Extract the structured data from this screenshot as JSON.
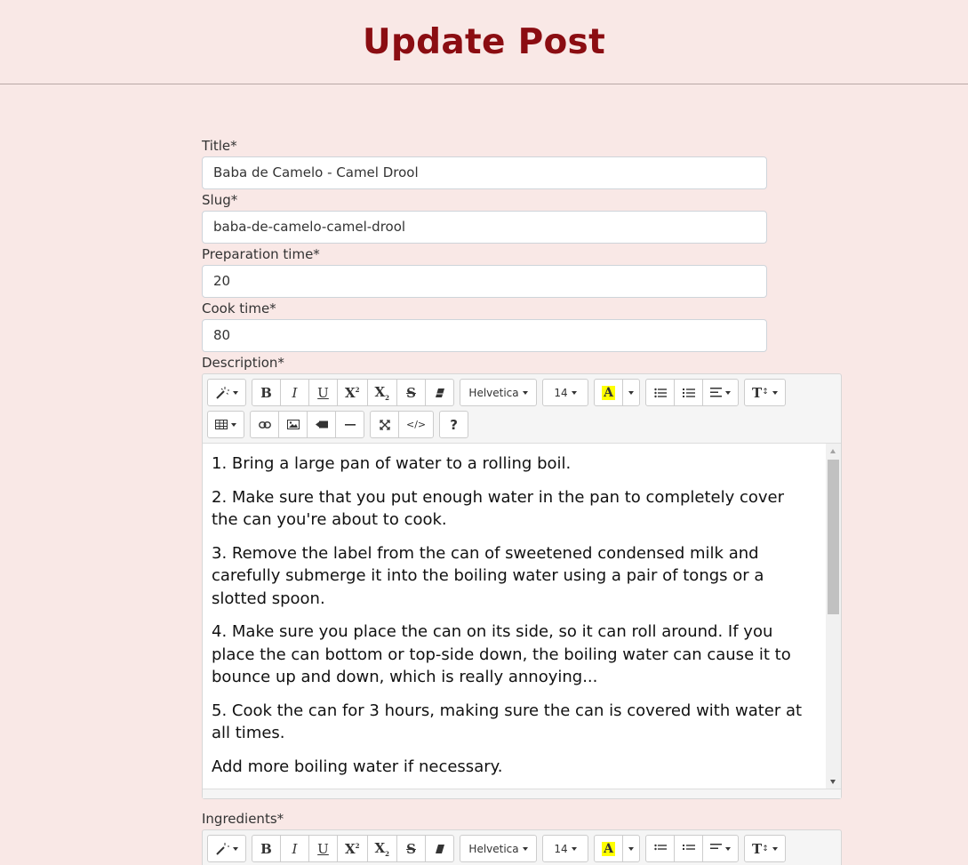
{
  "header": {
    "title": "Update Post"
  },
  "form": {
    "title_label": "Title*",
    "title_value": "Baba de Camelo - Camel Drool",
    "slug_label": "Slug*",
    "slug_value": "baba-de-camelo-camel-drool",
    "prep_label": "Preparation time*",
    "prep_value": "20",
    "cook_label": "Cook time*",
    "cook_value": "80",
    "description_label": "Description*",
    "ingredients_label": "Ingredients*"
  },
  "toolbar": {
    "bold": "B",
    "italic": "I",
    "underline": "U",
    "font_name": "Helvetica",
    "font_size": "14",
    "highlight": "A",
    "help": "?",
    "code": "</>",
    "text_style": "T"
  },
  "description": {
    "paragraphs": [
      "1. Bring a large pan of water to a rolling boil.",
      "2. Make sure that you put enough water in the pan to completely cover the can you're about to cook.",
      "3. Remove the label from the can of sweetened condensed milk and carefully submerge it into the boiling water using a pair of tongs or a slotted spoon.",
      "4. Make sure you place the can on its side, so it can roll around. If you place the can bottom or top-side down, the boiling water can cause it to bounce up and down, which is really annoying...",
      "5. Cook the can for 3 hours, making sure the can is covered with water at all times.",
      "Add more boiling water if necessary."
    ]
  },
  "colors": {
    "title": "#8b0d12",
    "background": "#f9e8e6",
    "highlight": "#ffff00"
  },
  "icons": [
    "magic-wand-icon",
    "table-icon",
    "link-icon",
    "image-icon",
    "video-icon",
    "horizontal-rule-icon",
    "fullscreen-icon",
    "code-view-icon",
    "unordered-list-icon",
    "ordered-list-icon",
    "align-icon",
    "eraser-icon"
  ]
}
